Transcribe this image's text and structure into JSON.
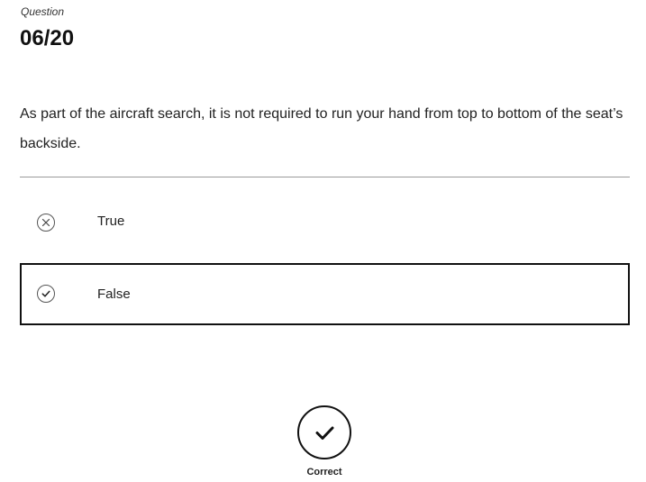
{
  "question": {
    "label": "Question",
    "number": "06/20",
    "text": "As part of the aircraft search, it is not required to run your hand from top to bottom of the seat’s backside."
  },
  "options": [
    {
      "label": "True",
      "icon": "x-circle-icon",
      "state": "incorrect"
    },
    {
      "label": "False",
      "icon": "check-circle-icon",
      "state": "correct-selected"
    }
  ],
  "result": {
    "label": "Correct",
    "icon": "checkmark-circle-icon"
  },
  "colors": {
    "text": "#222222",
    "border": "#111111",
    "divider": "#9a9a9a",
    "background": "#ffffff"
  }
}
